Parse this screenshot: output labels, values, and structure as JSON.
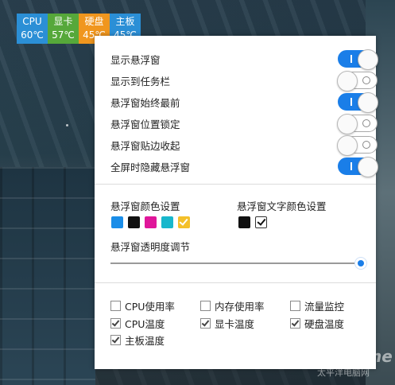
{
  "monitor_tiles": [
    {
      "name": "CPU",
      "value": "60℃",
      "color": "#2b8fd6"
    },
    {
      "name": "显卡",
      "value": "57℃",
      "color": "#56a83a"
    },
    {
      "name": "硬盘",
      "value": "45℃",
      "color": "#f0961e"
    },
    {
      "name": "主板",
      "value": "45℃",
      "color": "#2b8fd6"
    }
  ],
  "toggles": [
    {
      "label": "显示悬浮窗",
      "on": true
    },
    {
      "label": "显示到任务栏",
      "on": false
    },
    {
      "label": "悬浮窗始终最前",
      "on": true
    },
    {
      "label": "悬浮窗位置锁定",
      "on": false
    },
    {
      "label": "悬浮窗贴边收起",
      "on": false
    },
    {
      "label": "全屏时隐藏悬浮窗",
      "on": true
    }
  ],
  "colors_section": {
    "window_color_title": "悬浮窗颜色设置",
    "window_colors": [
      "#1a8de8",
      "#111111",
      "#e0169a",
      "#18b7cc",
      "#f4c02a"
    ],
    "window_color_selected": 4,
    "text_color_title": "悬浮窗文字颜色设置",
    "text_colors": [
      "#111111",
      "#ffffff"
    ],
    "text_color_selected": 1
  },
  "opacity": {
    "title": "悬浮窗透明度调节",
    "value_percent": 100
  },
  "checkboxes": [
    {
      "label": "CPU使用率",
      "checked": false
    },
    {
      "label": "内存使用率",
      "checked": false
    },
    {
      "label": "流量监控",
      "checked": false
    },
    {
      "label": "CPU温度",
      "checked": true
    },
    {
      "label": "显卡温度",
      "checked": true
    },
    {
      "label": "硬盘温度",
      "checked": true
    },
    {
      "label": "主板温度",
      "checked": true
    }
  ],
  "watermark": {
    "brand": "PConline",
    "sub": "太平洋电脑网"
  }
}
